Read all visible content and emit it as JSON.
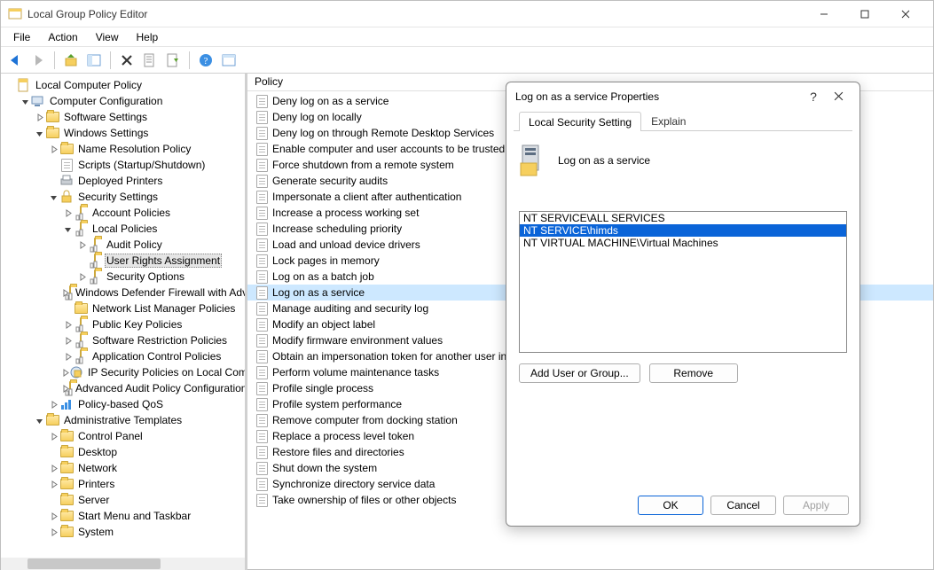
{
  "window": {
    "title": "Local Group Policy Editor"
  },
  "menu": [
    "File",
    "Action",
    "View",
    "Help"
  ],
  "tree": {
    "root": "Local Computer Policy",
    "items": [
      {
        "lvl": 0,
        "exp": true,
        "icon": "pc",
        "label": "Computer Configuration"
      },
      {
        "lvl": 1,
        "exp": false,
        "icon": "folder",
        "label": "Software Settings",
        "twisty": ">"
      },
      {
        "lvl": 1,
        "exp": true,
        "icon": "folder",
        "label": "Windows Settings"
      },
      {
        "lvl": 2,
        "exp": false,
        "icon": "folder",
        "label": "Name Resolution Policy",
        "twisty": ">"
      },
      {
        "lvl": 2,
        "exp": null,
        "icon": "script",
        "label": "Scripts (Startup/Shutdown)"
      },
      {
        "lvl": 2,
        "exp": null,
        "icon": "printer",
        "label": "Deployed Printers"
      },
      {
        "lvl": 2,
        "exp": true,
        "icon": "sec",
        "label": "Security Settings"
      },
      {
        "lvl": 3,
        "exp": false,
        "icon": "folder-s",
        "label": "Account Policies",
        "twisty": ">"
      },
      {
        "lvl": 3,
        "exp": true,
        "icon": "folder-s",
        "label": "Local Policies"
      },
      {
        "lvl": 4,
        "exp": false,
        "icon": "folder-s",
        "label": "Audit Policy",
        "twisty": ">"
      },
      {
        "lvl": 4,
        "exp": null,
        "icon": "folder-s",
        "label": "User Rights Assignment",
        "selected": true
      },
      {
        "lvl": 4,
        "exp": false,
        "icon": "folder-s",
        "label": "Security Options",
        "twisty": ">"
      },
      {
        "lvl": 3,
        "exp": false,
        "icon": "folder-s",
        "label": "Windows Defender Firewall with Advanced Security",
        "twisty": ">"
      },
      {
        "lvl": 3,
        "exp": null,
        "icon": "folder",
        "label": "Network List Manager Policies"
      },
      {
        "lvl": 3,
        "exp": false,
        "icon": "folder-s",
        "label": "Public Key Policies",
        "twisty": ">"
      },
      {
        "lvl": 3,
        "exp": false,
        "icon": "folder-s",
        "label": "Software Restriction Policies",
        "twisty": ">"
      },
      {
        "lvl": 3,
        "exp": false,
        "icon": "folder-s",
        "label": "Application Control Policies",
        "twisty": ">"
      },
      {
        "lvl": 3,
        "exp": false,
        "icon": "ipsec",
        "label": "IP Security Policies on Local Computer",
        "twisty": ">"
      },
      {
        "lvl": 3,
        "exp": false,
        "icon": "folder-s",
        "label": "Advanced Audit Policy Configuration",
        "twisty": ">"
      },
      {
        "lvl": 2,
        "exp": false,
        "icon": "qos",
        "label": "Policy-based QoS",
        "twisty": ">"
      },
      {
        "lvl": 1,
        "exp": true,
        "icon": "folder",
        "label": "Administrative Templates"
      },
      {
        "lvl": 2,
        "exp": false,
        "icon": "folder",
        "label": "Control Panel",
        "twisty": ">"
      },
      {
        "lvl": 2,
        "exp": null,
        "icon": "folder",
        "label": "Desktop"
      },
      {
        "lvl": 2,
        "exp": false,
        "icon": "folder",
        "label": "Network",
        "twisty": ">"
      },
      {
        "lvl": 2,
        "exp": false,
        "icon": "folder",
        "label": "Printers",
        "twisty": ">"
      },
      {
        "lvl": 2,
        "exp": null,
        "icon": "folder",
        "label": "Server"
      },
      {
        "lvl": 2,
        "exp": false,
        "icon": "folder",
        "label": "Start Menu and Taskbar",
        "twisty": ">"
      },
      {
        "lvl": 2,
        "exp": false,
        "icon": "folder",
        "label": "System",
        "twisty": ">"
      }
    ]
  },
  "list": {
    "header": "Policy",
    "items": [
      "Deny log on as a service",
      "Deny log on locally",
      "Deny log on through Remote Desktop Services",
      "Enable computer and user accounts to be trusted for delegation",
      "Force shutdown from a remote system",
      "Generate security audits",
      "Impersonate a client after authentication",
      "Increase a process working set",
      "Increase scheduling priority",
      "Load and unload device drivers",
      "Lock pages in memory",
      "Log on as a batch job",
      "Log on as a service",
      "Manage auditing and security log",
      "Modify an object label",
      "Modify firmware environment values",
      "Obtain an impersonation token for another user in the same session",
      "Perform volume maintenance tasks",
      "Profile single process",
      "Profile system performance",
      "Remove computer from docking station",
      "Replace a process level token",
      "Restore files and directories",
      "Shut down the system",
      "Synchronize directory service data",
      "Take ownership of files or other objects"
    ],
    "selected_index": 12
  },
  "dialog": {
    "title": "Log on as a service Properties",
    "tabs": [
      "Local Security Setting",
      "Explain"
    ],
    "active_tab": 0,
    "heading": "Log on as a service",
    "entries": [
      "NT SERVICE\\ALL SERVICES",
      "NT SERVICE\\himds",
      "NT VIRTUAL MACHINE\\Virtual Machines"
    ],
    "selected_entry": 1,
    "add_label": "Add User or Group...",
    "remove_label": "Remove",
    "ok_label": "OK",
    "cancel_label": "Cancel",
    "apply_label": "Apply"
  }
}
